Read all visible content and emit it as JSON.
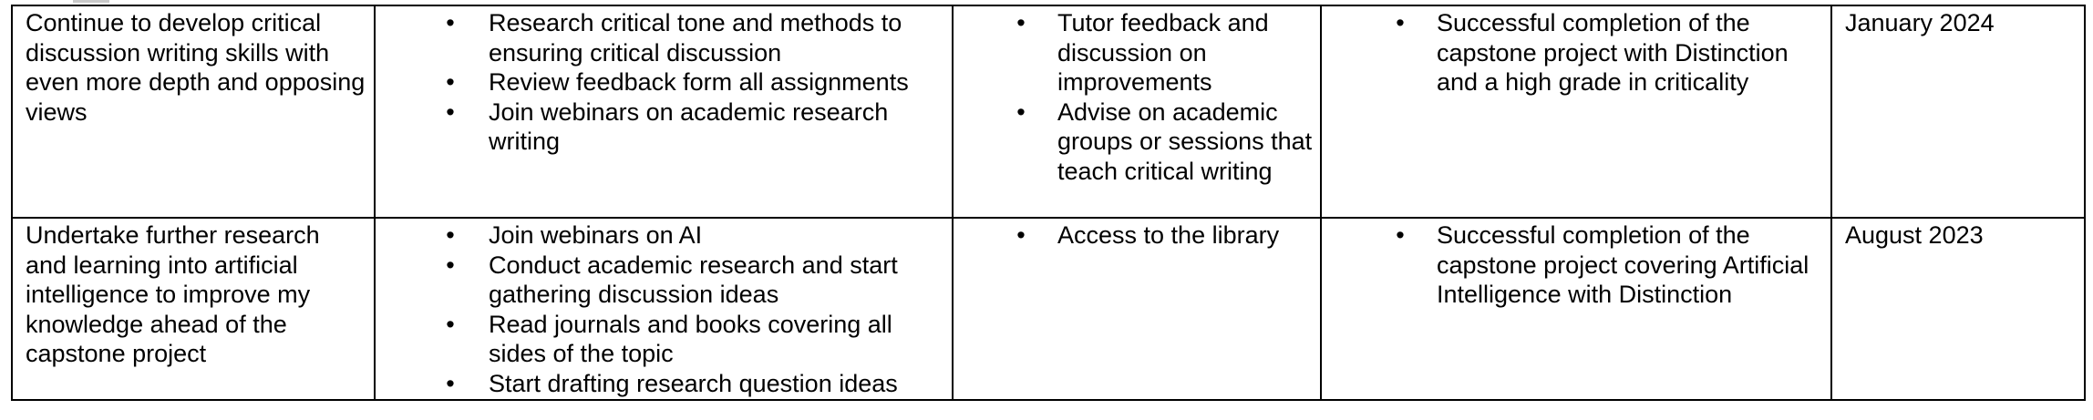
{
  "table": {
    "rows": [
      {
        "goal": "Continue to develop critical discussion writing skills with even more depth and opposing views",
        "actions": [
          "Research critical tone and methods to ensuring critical discussion",
          "Review feedback form all assignments",
          "Join webinars on academic research writing"
        ],
        "support": [
          "Tutor feedback and discussion on improvements",
          "Advise on academic groups or sessions that teach critical writing"
        ],
        "success_measures": [
          "Successful completion of the capstone project with Distinction and a high grade in criticality"
        ],
        "target_date": "January 2024"
      },
      {
        "goal": "Undertake further research and learning into artificial intelligence to improve my knowledge ahead of the capstone project",
        "actions": [
          "Join webinars on AI",
          "Conduct academic research and start gathering discussion ideas",
          "Read journals and books covering all sides of the topic",
          "Start drafting research question ideas"
        ],
        "support": [
          "Access to the library"
        ],
        "success_measures": [
          "Successful completion of the capstone project covering Artificial Intelligence with Distinction"
        ],
        "target_date": "August 2023"
      }
    ]
  },
  "bullet_glyph": "•"
}
